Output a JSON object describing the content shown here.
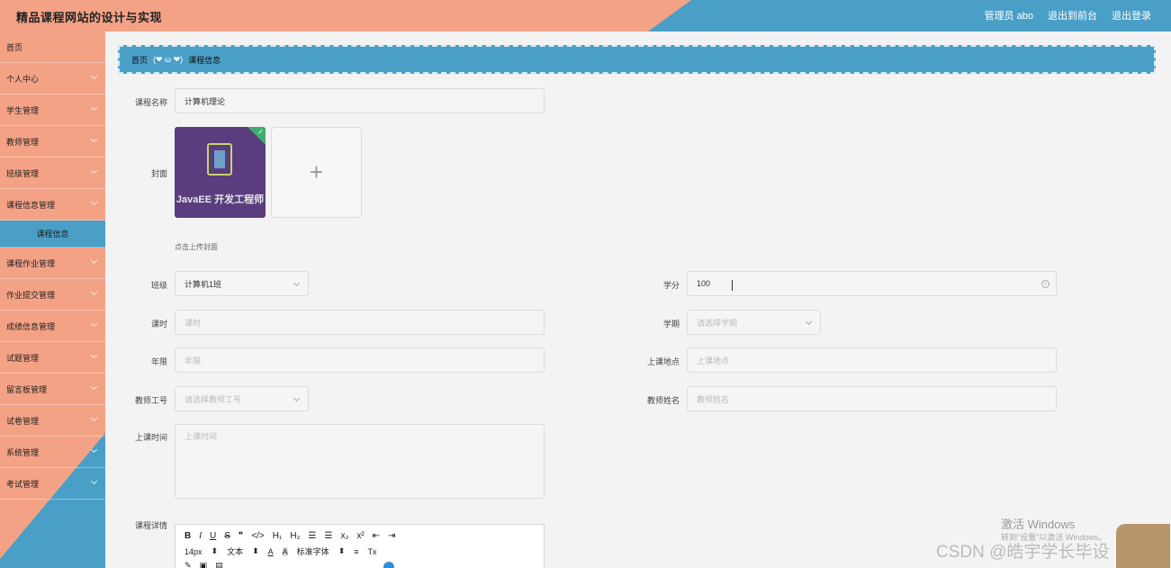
{
  "header": {
    "title": "精品课程网站的设计与实现",
    "nav": [
      "管理员 abo",
      "退出到前台",
      "退出登录"
    ]
  },
  "sidebar": {
    "items": [
      {
        "label": "首页",
        "chevron": false
      },
      {
        "label": "个人中心",
        "chevron": true
      },
      {
        "label": "学生管理",
        "chevron": true
      },
      {
        "label": "教师管理",
        "chevron": true
      },
      {
        "label": "班级管理",
        "chevron": true
      },
      {
        "label": "课程信息管理",
        "chevron": true
      },
      {
        "label": "课程信息",
        "sub": true
      },
      {
        "label": "课程作业管理",
        "chevron": true
      },
      {
        "label": "作业提交管理",
        "chevron": true
      },
      {
        "label": "成绩信息管理",
        "chevron": true
      },
      {
        "label": "试题管理",
        "chevron": true
      },
      {
        "label": "留言板管理",
        "chevron": true
      },
      {
        "label": "试卷管理",
        "chevron": true
      },
      {
        "label": "系统管理",
        "chevron": true
      },
      {
        "label": "考试管理",
        "chevron": true
      }
    ]
  },
  "breadcrumb": {
    "home": "首页",
    "separator": "(❤ ω ❤)",
    "current": "课程信息"
  },
  "form": {
    "course_name": {
      "label": "课程名称",
      "value": "计算机理论"
    },
    "cover": {
      "label": "封面",
      "image_text": "JavaEE 开发工程师",
      "hint": "点击上传封面",
      "add_glyph": "+"
    },
    "class": {
      "label": "班级",
      "value": "计算机1班"
    },
    "credit": {
      "label": "学分",
      "value": "100"
    },
    "hours": {
      "label": "课时",
      "placeholder": "课时"
    },
    "semester": {
      "label": "学期",
      "placeholder": "请选择学期"
    },
    "years": {
      "label": "年限",
      "placeholder": "年限"
    },
    "location": {
      "label": "上课地点",
      "placeholder": "上课地点"
    },
    "teacher_id": {
      "label": "教师工号",
      "placeholder": "请选择教师工号"
    },
    "teacher_name": {
      "label": "教师姓名",
      "placeholder": "教师姓名"
    },
    "class_time": {
      "label": "上课时间",
      "placeholder": "上课时间"
    },
    "details": {
      "label": "课程详情"
    }
  },
  "editor": {
    "row1": [
      "B",
      "I",
      "U",
      "S",
      "❞",
      "</>",
      "H₁",
      "H₂",
      "☰",
      "☰",
      "x₂",
      "x²",
      "⇤",
      "⇥"
    ],
    "row2": [
      "14px",
      "⬍",
      "文本",
      "⬍",
      "A",
      "A",
      "标准字体",
      "⬍",
      "≡",
      "Tx"
    ],
    "row3": [
      "✎",
      "▣",
      "▤"
    ]
  },
  "watermark": {
    "activate": "激活 Windows",
    "activate_sub": "转到\"设置\"以激活 Windows。",
    "csdn": "CSDN @皓宇学长毕设"
  }
}
